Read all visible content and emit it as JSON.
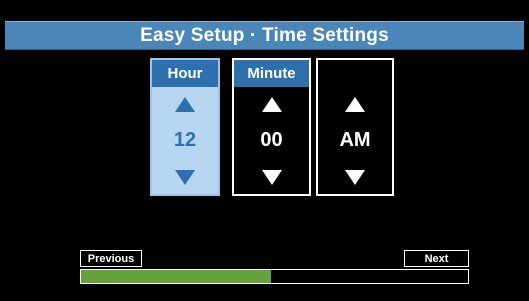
{
  "header": {
    "title": "Easy Setup · Time Settings"
  },
  "spinners": [
    {
      "label": "Hour",
      "value": "12",
      "selected": true
    },
    {
      "label": "Minute",
      "value": "00",
      "selected": false
    },
    {
      "label": "",
      "value": "AM",
      "selected": false
    }
  ],
  "footer": {
    "previous_label": "Previous",
    "next_label": "Next",
    "progress": 0.49,
    "progress_color": "#66a23c"
  },
  "colors": {
    "accent": "#2e6fae",
    "title_bar": "#4a86b8",
    "selected_bg": "#b7d6f2",
    "background": "#000000"
  }
}
